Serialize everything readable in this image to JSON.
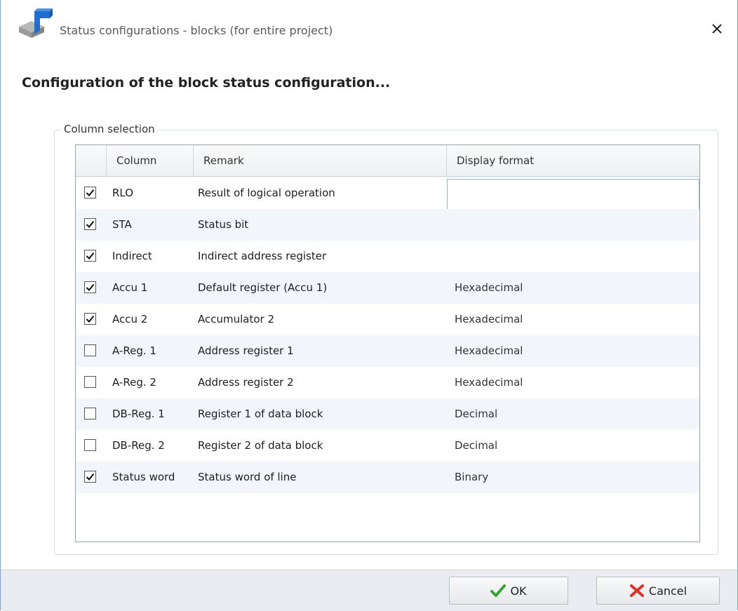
{
  "window": {
    "title": "Status configurations - blocks (for entire project)",
    "heading": "Configuration of the block status configuration..."
  },
  "group": {
    "label": "Column selection"
  },
  "table": {
    "headers": {
      "column": "Column",
      "remark": "Remark",
      "format": "Display format"
    },
    "rows": [
      {
        "checked": true,
        "column": "RLO",
        "remark": "Result of logical operation",
        "format": ""
      },
      {
        "checked": true,
        "column": "STA",
        "remark": "Status bit",
        "format": ""
      },
      {
        "checked": true,
        "column": "Indirect",
        "remark": "Indirect address register",
        "format": ""
      },
      {
        "checked": true,
        "column": "Accu 1",
        "remark": "Default register (Accu 1)",
        "format": "Hexadecimal"
      },
      {
        "checked": true,
        "column": "Accu 2",
        "remark": "Accumulator 2",
        "format": "Hexadecimal"
      },
      {
        "checked": false,
        "column": "A-Reg. 1",
        "remark": "Address register 1",
        "format": "Hexadecimal"
      },
      {
        "checked": false,
        "column": "A-Reg. 2",
        "remark": "Address register 2",
        "format": "Hexadecimal"
      },
      {
        "checked": false,
        "column": "DB-Reg. 1",
        "remark": "Register 1 of data block",
        "format": "Decimal"
      },
      {
        "checked": false,
        "column": "DB-Reg. 2",
        "remark": "Register 2 of data block",
        "format": "Decimal"
      },
      {
        "checked": true,
        "column": "Status word",
        "remark": "Status word of line",
        "format": "Binary"
      }
    ]
  },
  "buttons": {
    "ok": "OK",
    "cancel": "Cancel"
  },
  "icons": {
    "app": "app-icon",
    "close": "close-icon",
    "ok": "checkmark-icon",
    "cancel": "x-icon"
  },
  "colors": {
    "ok_icon": "#3aa335",
    "cancel_icon": "#d9342b",
    "app_icon_blue": "#1e6fd0"
  }
}
